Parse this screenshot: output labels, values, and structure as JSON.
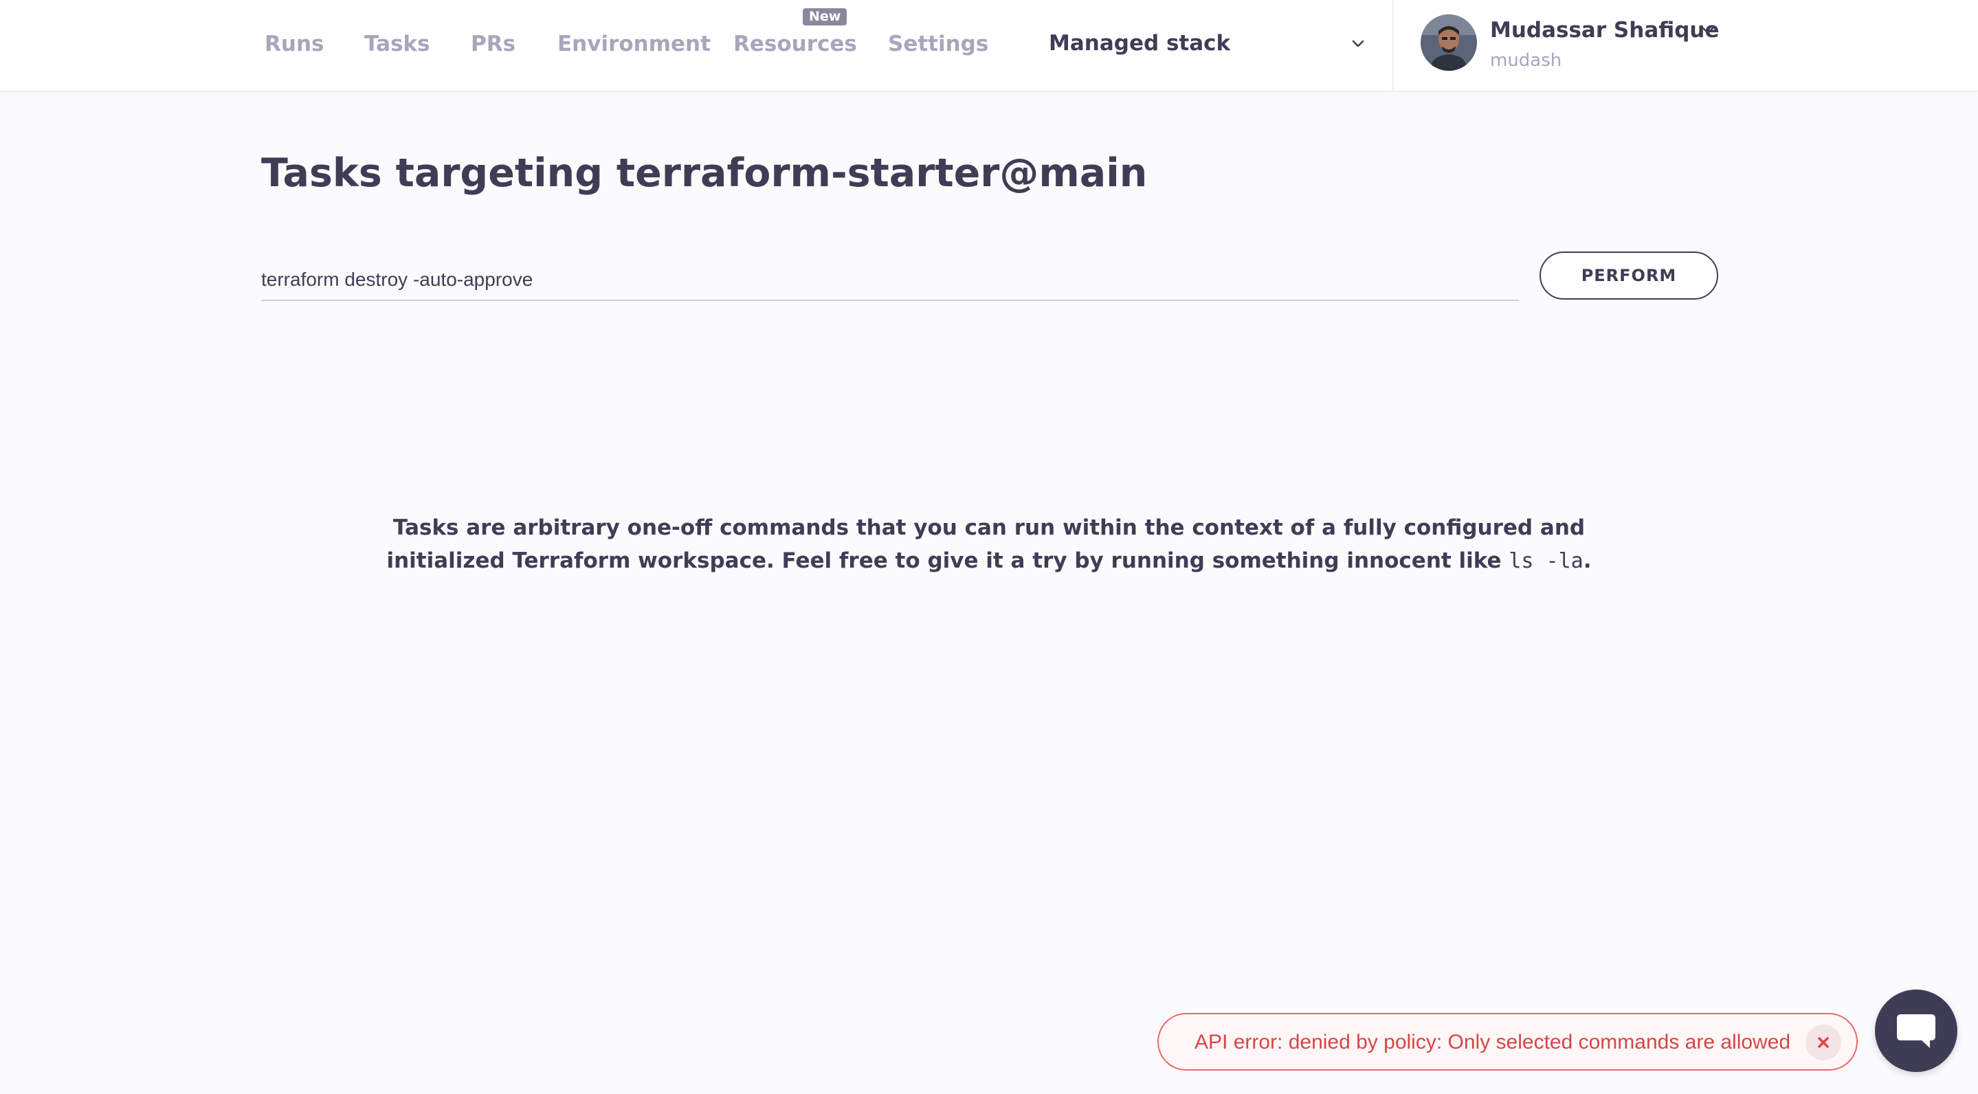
{
  "nav": {
    "items": [
      {
        "label": "Runs"
      },
      {
        "label": "Tasks"
      },
      {
        "label": "PRs"
      },
      {
        "label": "Environment"
      },
      {
        "label": "Resources",
        "badge": "New"
      },
      {
        "label": "Settings"
      }
    ]
  },
  "stack_select": {
    "value": "Managed stack",
    "icon": "chevron-down-icon"
  },
  "user": {
    "name": "Mudassar Shafique",
    "handle": "mudash",
    "icon": "chevron-down-icon"
  },
  "page": {
    "title": "Tasks targeting terraform-starter@main"
  },
  "command": {
    "value": "terraform destroy -auto-approve"
  },
  "perform_label": "PERFORM",
  "empty_state": {
    "text": "Tasks are arbitrary one-off commands that you can run within the context of a fully configured and initialized Terraform workspace. Feel free to give it a try by running something innocent like ",
    "code": "ls -la",
    "suffix": "."
  },
  "toast": {
    "message": "API error: denied by policy: Only selected commands are allowed",
    "close_icon": "close-icon"
  },
  "chat": {
    "icon": "chat-bubble-icon"
  },
  "colors": {
    "accent": "#3f3d56",
    "nav_inactive": "#a7a6bc",
    "error": "#d94545",
    "background": "#fbfbfd"
  }
}
